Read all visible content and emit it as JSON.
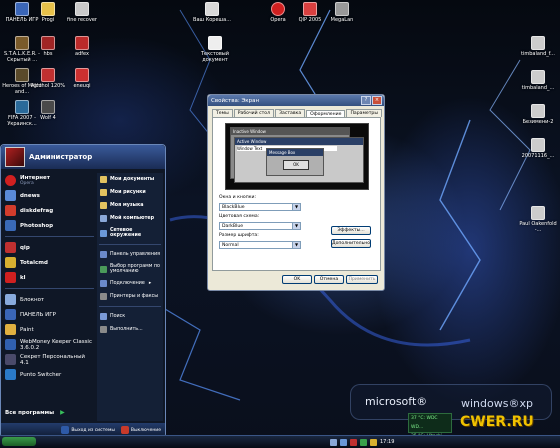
{
  "desktop": {
    "icons": [
      {
        "label": "ПАНЕЛЬ ИГР",
        "color": "#3a66b8"
      },
      {
        "label": "Progi",
        "color": "#e7c14a"
      },
      {
        "label": "fine recover",
        "color": "#c9c9c9"
      },
      {
        "label": "Ваш Кореша...",
        "color": "#d8d8d8"
      },
      {
        "label": "Opera",
        "color": "#d02020"
      },
      {
        "label": "QIP 2005",
        "color": "#d94040"
      },
      {
        "label": "MegaLan",
        "color": "#999999"
      },
      {
        "label": "S.T.A.L.K.E.R. - Скрытый ...",
        "color": "#7a5b2a"
      },
      {
        "label": "hbs",
        "color": "#a02525"
      },
      {
        "label": "adfex",
        "color": "#bb2a2a"
      },
      {
        "label": "Текстовый документ",
        "color": "#eeeeee"
      },
      {
        "label": "Heroes of Might and...",
        "color": "#5a4a2a"
      },
      {
        "label": "Alcohol 120%",
        "color": "#c03030"
      },
      {
        "label": "eneuqi",
        "color": "#cc3030"
      },
      {
        "label": "FIFA 2007 - Украинск...",
        "color": "#2a6a9a"
      },
      {
        "label": "Wolf 4",
        "color": "#4a4a4a"
      },
      {
        "label": "timbaland_f...",
        "color": "#cccccc"
      },
      {
        "label": "timbaland_...",
        "color": "#cccccc"
      },
      {
        "label": "Безимени-2",
        "color": "#cccccc"
      },
      {
        "label": "20071116_...",
        "color": "#cccccc"
      },
      {
        "label": "Paul Oakenfold -...",
        "color": "#cccccc"
      }
    ]
  },
  "start_menu": {
    "user_name": "Администратор",
    "pinned": [
      {
        "name": "Интернет",
        "sub": "Opera",
        "color": "#d02020"
      },
      {
        "name": "dnews",
        "sub": "",
        "color": "#5a8ad8"
      },
      {
        "name": "diskdefrag",
        "sub": "",
        "color": "#d23c2c"
      },
      {
        "name": "Photoshop",
        "sub": "",
        "color": "#3a6ab8"
      }
    ],
    "recent": [
      {
        "name": "qip",
        "sub": "",
        "color": "#c03030"
      },
      {
        "name": "Totalcmd",
        "sub": "",
        "color": "#d8b030"
      },
      {
        "name": "kl",
        "sub": "",
        "color": "#d02020"
      },
      {
        "name": "Блокнот",
        "sub": "",
        "color": "#88aadd"
      },
      {
        "name": "ПАНЕЛЬ ИГР",
        "sub": "",
        "color": "#3a66b8"
      },
      {
        "name": "Paint",
        "sub": "",
        "color": "#e0b040"
      },
      {
        "name": "WebMoney Keeper Classic 3.6.0.2",
        "sub": "",
        "color": "#3060b0"
      },
      {
        "name": "Секрет Персональный 4.1",
        "sub": "",
        "color": "#4a4a6a"
      },
      {
        "name": "Punto Switcher",
        "sub": "",
        "color": "#2a7ac8"
      }
    ],
    "right_bold": [
      {
        "name": "Мои документы",
        "color": "#e3c360"
      },
      {
        "name": "Мои рисунки",
        "color": "#e3c360"
      },
      {
        "name": "Моя музыка",
        "color": "#e3c360"
      },
      {
        "name": "Мой компьютер",
        "color": "#8aa8d8"
      },
      {
        "name": "Сетевое окружение",
        "color": "#6a98d8"
      }
    ],
    "right_plain": [
      {
        "name": "Панель управления",
        "color": "#6a8acb"
      },
      {
        "name": "Выбор программ по умолчанию",
        "color": "#4a9a5a"
      },
      {
        "name": "Подключение",
        "color": "#6a8acb"
      },
      {
        "name": "Принтеры и факсы",
        "color": "#8a8a8a"
      },
      {
        "name": "Поиск",
        "color": "#7a9ad8"
      },
      {
        "name": "Выполнить...",
        "color": "#8a8a8a"
      }
    ],
    "all_programs": "Все программы",
    "logoff": "Выход из системы",
    "shutdown": "Выключение"
  },
  "dialog": {
    "title": "Свойства: Экран",
    "tabs": [
      "Темы",
      "Рабочий стол",
      "Заставка",
      "Оформление",
      "Параметры"
    ],
    "active_tab": 3,
    "preview": {
      "inactive_window": "Inactive Window",
      "active_window": "Active Window",
      "window_text": "Window Text",
      "message_box": "Message Box",
      "ok": "OK"
    },
    "windows_buttons_label": "Окна и кнопки:",
    "windows_buttons_value": "BlackBlue",
    "color_scheme_label": "Цветовая схема:",
    "color_scheme_value": "DarkBlue",
    "font_size_label": "Размер шрифта:",
    "font_size_value": "Normal",
    "effects_btn": "Эффекты...",
    "advanced_btn": "Дополнительно",
    "ok_btn": "OK",
    "cancel_btn": "Отмена",
    "apply_btn": "Применить"
  },
  "branding": {
    "microsoft": "microsoft®",
    "windows": "windows®xp"
  },
  "gadget": {
    "line1": "37 °C: WDC WD...",
    "line2": "35 °C: Hitachi..."
  },
  "watermark": "CWER.RU",
  "taskbar": {
    "clock": "17:19"
  }
}
